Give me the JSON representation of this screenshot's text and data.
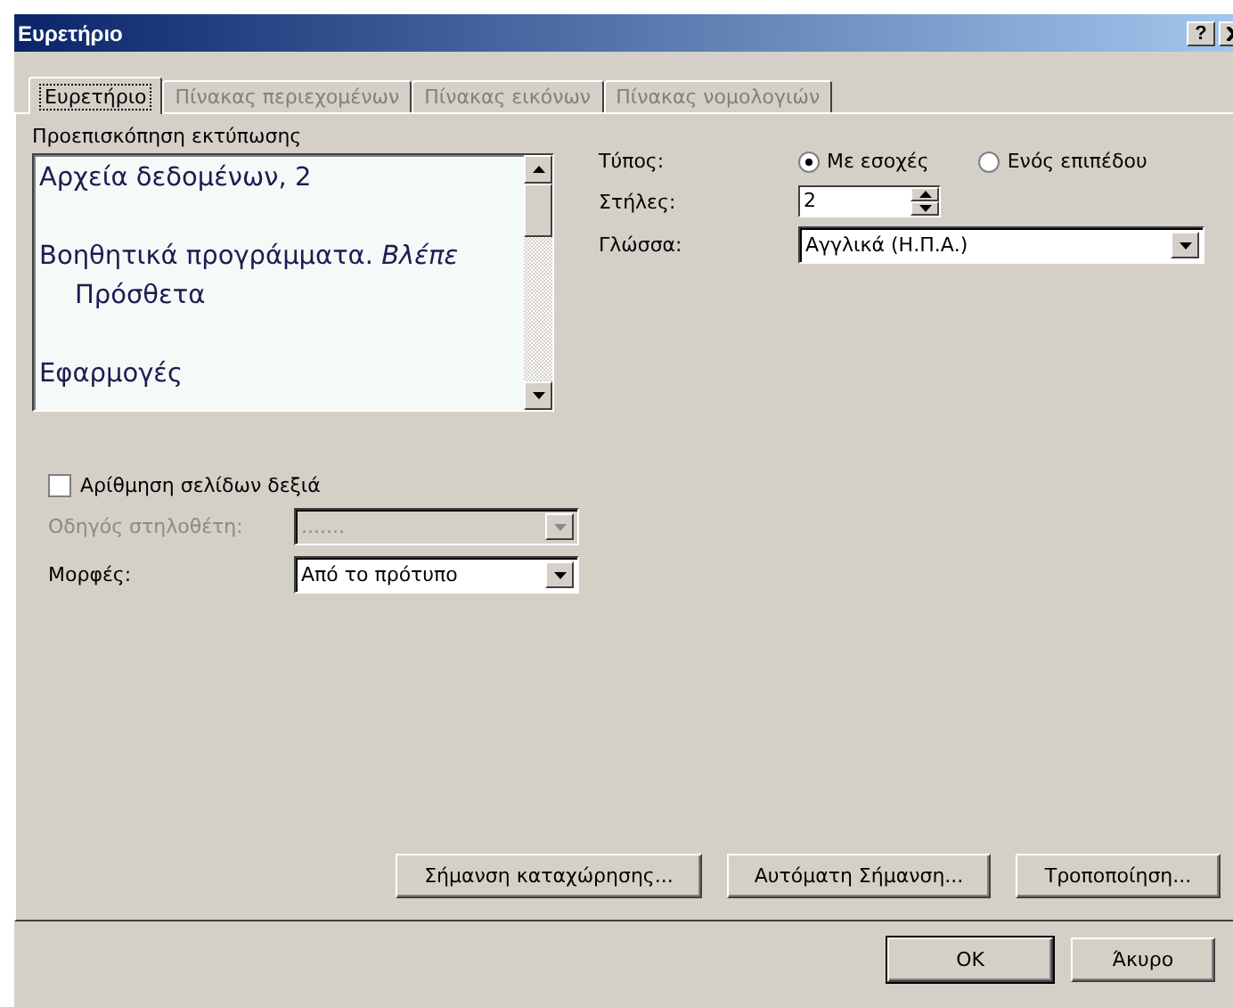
{
  "window": {
    "title": "Ευρετήριο",
    "help_button": "?"
  },
  "tabs": [
    {
      "label": "Ευρετήριο",
      "selected": true
    },
    {
      "label": "Πίνακας περιεχομένων",
      "selected": false
    },
    {
      "label": "Πίνακας εικόνων",
      "selected": false
    },
    {
      "label": "Πίνακας νομολογιών",
      "selected": false
    }
  ],
  "preview": {
    "label": "Προεπισκόπηση εκτύπωσης",
    "entries": [
      {
        "text": "Αρχεία δεδομένων, 2"
      },
      {
        "text": "Βοηθητικά προγράμματα. *Βλέπε*",
        "continuation": "Πρόσθετα"
      },
      {
        "text": "Εφαρμογές"
      }
    ]
  },
  "type": {
    "label": "Τύπος:",
    "options": [
      {
        "label": "Με εσοχές",
        "selected": true
      },
      {
        "label": "Ενός επιπέδου",
        "selected": false
      }
    ]
  },
  "columns": {
    "label": "Στήλες:",
    "value": "2"
  },
  "language": {
    "label": "Γλώσσα:",
    "value": "Αγγλικά (Η.Π.Α.)"
  },
  "right_align": {
    "label": "Αρίθμηση σελίδων δεξιά",
    "checked": false
  },
  "tab_leader": {
    "label": "Οδηγός στηλοθέτη:",
    "value": ".......",
    "disabled": true
  },
  "formats": {
    "label": "Μορφές:",
    "value": "Από το πρότυπο"
  },
  "buttons": [
    "Σήμανση καταχώρησης...",
    "Αυτόματη Σήμανση...",
    "Τροποποίηση..."
  ],
  "footer_buttons": [
    {
      "label": "OK",
      "default": true
    },
    {
      "label": "Άκυρο",
      "default": false
    }
  ]
}
